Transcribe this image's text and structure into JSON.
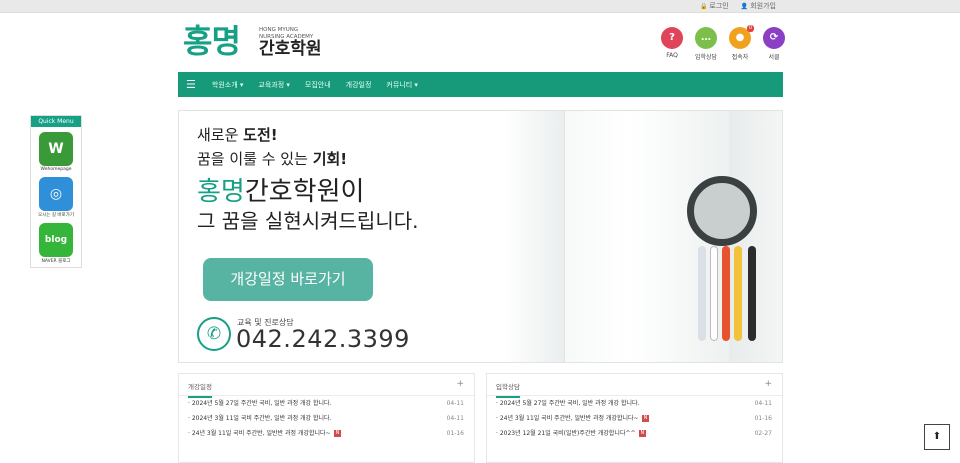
{
  "topbar": {
    "login": "로그인",
    "join": "회원가입"
  },
  "logo": {
    "big": "홍명",
    "en_line1": "HONG MYUNG",
    "en_line2": "NURSING ACADEMY",
    "ko": "간호학원"
  },
  "quick_icons": [
    {
      "label": "FAQ",
      "glyph": "?",
      "color": "#e0445b",
      "icon": "question-icon"
    },
    {
      "label": "입학상담",
      "glyph": "…",
      "color": "#7cc04b",
      "icon": "chat-icon"
    },
    {
      "label": "접속자",
      "glyph": "●",
      "color": "#f2a11f",
      "icon": "visitor-icon",
      "badge": "0"
    },
    {
      "label": "서클",
      "glyph": "⟳",
      "color": "#8a3fc4",
      "icon": "circle-icon"
    }
  ],
  "nav": {
    "items": [
      "학원소개 ▾",
      "교육과정 ▾",
      "모집안내",
      "개강일정",
      "커뮤니티 ▾"
    ]
  },
  "hero": {
    "line1_a": "새로운 ",
    "line1_b": "도전!",
    "line2_a": "꿈을 이룰 수 있는 ",
    "line2_b": "기회!",
    "line3_green": "홍명",
    "line3_rest": "간호학원이",
    "line4": "그 꿈을 실현시켜드립니다.",
    "cta": "개강일정 바로가기",
    "phone_label": "교육 및 진로상담",
    "phone_number": "042.242.3399"
  },
  "panels": [
    {
      "title": "개강일정",
      "rows": [
        {
          "text": "· 2024년 5월 27일 주간반 국비, 일반 과정 개강 합니다.",
          "date": "04-11",
          "new": false
        },
        {
          "text": "· 2024년 3월 11일 국비 주간반, 일반 과정 개강 합니다.",
          "date": "04-11",
          "new": false
        },
        {
          "text": "· 24년 3월 11일 국비 주간반, 일반반 과정 개강합니다~",
          "date": "01-16",
          "new": true
        }
      ]
    },
    {
      "title": "입학상담",
      "rows": [
        {
          "text": "· 2024년 5월 27일 주간반 국비, 일반 과정 개강 합니다.",
          "date": "04-11",
          "new": false
        },
        {
          "text": "· 24년 3월 11일 국비 주간반, 일반반 과정 개강합니다~",
          "date": "01-16",
          "new": true
        },
        {
          "text": "· 2023년 12월 21일 국비(일반)주간반 개강합니다^^",
          "date": "02-27",
          "new": true
        }
      ]
    }
  ],
  "new_badge": "N",
  "quick_menu": {
    "title": "Quick Menu",
    "items": [
      {
        "glyph": "W",
        "label": "Wehomepage",
        "color": "#3a9a3a",
        "icon": "w-logo-icon"
      },
      {
        "glyph": "◎",
        "label": "오시는 길 바로가기",
        "color": "#2f8fd8",
        "icon": "location-icon"
      },
      {
        "glyph": "blog",
        "label": "NAVER 블로그",
        "color": "#35b53a",
        "icon": "blog-icon"
      }
    ]
  },
  "totop": "⬆"
}
